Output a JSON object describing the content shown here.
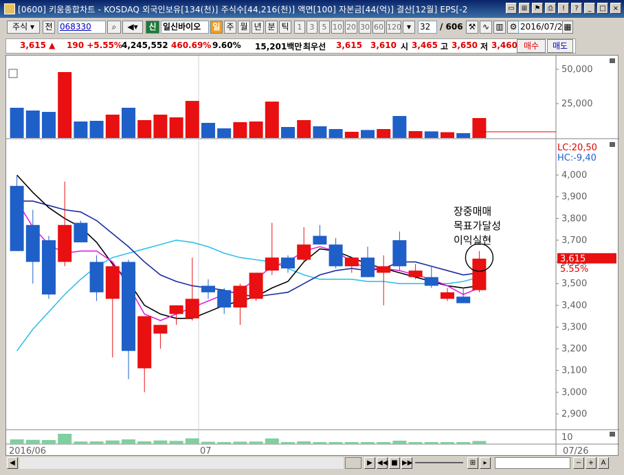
{
  "window": {
    "title": "[0600] 키움종합차트 - KOSDAQ 외국인보유[134(천)] 주식수[44,216(천)] 액면[100] 자본금[44(억)] 결산[12월] EPS[-2"
  },
  "toolbar": {
    "market_label": "주식",
    "prev_label": "전",
    "code": "068330",
    "new_badge": "신",
    "stock_name": "일신바이오",
    "day_badge": "일",
    "week": "주",
    "month": "월",
    "year": "년",
    "minute": "분",
    "tick": "틱",
    "intervals": [
      "1",
      "3",
      "5",
      "10",
      "20",
      "30",
      "60",
      "120"
    ],
    "count": "32",
    "total": "/ 606",
    "date": "2016/07/2"
  },
  "price": {
    "current": "3,615 ▲",
    "change": "190 +5.55%",
    "volume": "4,245,552",
    "vol_ratio": "460.69%",
    "turnover": "9.60%",
    "amount": "15,201백만",
    "best_label": "최우선",
    "ask": "3,615",
    "bid": "3,610",
    "open_label": "시",
    "open": "3,465",
    "high_label": "고",
    "high": "3,650",
    "low_label": "저",
    "low": "3,460",
    "buy_label": "매수",
    "sell_label": "매도"
  },
  "chart_data": {
    "type": "candlestick",
    "bullish_color": "#e81010",
    "bearish_color": "#1f5fc8",
    "volume_axis": {
      "ticks": [
        "50,000",
        "25,000"
      ],
      "ylim": [
        0,
        55000
      ]
    },
    "price_axis": {
      "ticks": [
        "4,000",
        "3,900",
        "3,800",
        "3,700",
        "3,600",
        "3,500",
        "3,400",
        "3,300",
        "3,200",
        "3,100",
        "3,000",
        "2,900"
      ],
      "ylim": [
        2830,
        4080
      ]
    },
    "lc_label": "LC:20,50",
    "hc_label": "HC:-9,40",
    "last_price_tag": "3,615",
    "last_change_tag": "5.55%",
    "sub_axis_tick": "10",
    "x_labels": [
      "2016/06",
      "07",
      "07/26"
    ],
    "candles": [
      {
        "o": 3950,
        "h": 4000,
        "l": 3650,
        "c": 3650,
        "v": 22000
      },
      {
        "o": 3770,
        "h": 3840,
        "l": 3500,
        "c": 3600,
        "v": 20000
      },
      {
        "o": 3700,
        "h": 3720,
        "l": 3430,
        "c": 3450,
        "v": 19000
      },
      {
        "o": 3600,
        "h": 3970,
        "l": 3580,
        "c": 3770,
        "v": 48000
      },
      {
        "o": 3780,
        "h": 3790,
        "l": 3690,
        "c": 3690,
        "v": 12000
      },
      {
        "o": 3600,
        "h": 3630,
        "l": 3420,
        "c": 3460,
        "v": 12500
      },
      {
        "o": 3430,
        "h": 3590,
        "l": 3160,
        "c": 3580,
        "v": 17000
      },
      {
        "o": 3600,
        "h": 3610,
        "l": 3060,
        "c": 3190,
        "v": 22000
      },
      {
        "o": 3110,
        "h": 3350,
        "l": 3000,
        "c": 3350,
        "v": 13000
      },
      {
        "o": 3270,
        "h": 3310,
        "l": 3200,
        "c": 3310,
        "v": 17000
      },
      {
        "o": 3360,
        "h": 3380,
        "l": 3310,
        "c": 3400,
        "v": 15000
      },
      {
        "o": 3340,
        "h": 3620,
        "l": 3330,
        "c": 3430,
        "v": 27000
      },
      {
        "o": 3490,
        "h": 3520,
        "l": 3430,
        "c": 3460,
        "v": 11000
      },
      {
        "o": 3470,
        "h": 3480,
        "l": 3360,
        "c": 3390,
        "v": 7000
      },
      {
        "o": 3390,
        "h": 3500,
        "l": 3310,
        "c": 3490,
        "v": 11500
      },
      {
        "o": 3430,
        "h": 3550,
        "l": 3420,
        "c": 3550,
        "v": 12000
      },
      {
        "o": 3560,
        "h": 3780,
        "l": 3540,
        "c": 3620,
        "v": 26500
      },
      {
        "o": 3620,
        "h": 3630,
        "l": 3550,
        "c": 3570,
        "v": 8000
      },
      {
        "o": 3610,
        "h": 3760,
        "l": 3600,
        "c": 3680,
        "v": 13000
      },
      {
        "o": 3720,
        "h": 3770,
        "l": 3680,
        "c": 3680,
        "v": 8500
      },
      {
        "o": 3680,
        "h": 3710,
        "l": 3570,
        "c": 3580,
        "v": 6500
      },
      {
        "o": 3580,
        "h": 3620,
        "l": 3550,
        "c": 3620,
        "v": 4500
      },
      {
        "o": 3620,
        "h": 3670,
        "l": 3530,
        "c": 3530,
        "v": 5800
      },
      {
        "o": 3550,
        "h": 3630,
        "l": 3400,
        "c": 3580,
        "v": 6500
      },
      {
        "o": 3700,
        "h": 3740,
        "l": 3560,
        "c": 3580,
        "v": 16000
      },
      {
        "o": 3530,
        "h": 3590,
        "l": 3520,
        "c": 3560,
        "v": 5000
      },
      {
        "o": 3530,
        "h": 3580,
        "l": 3480,
        "c": 3490,
        "v": 4800
      },
      {
        "o": 3430,
        "h": 3480,
        "l": 3420,
        "c": 3460,
        "v": 4200
      },
      {
        "o": 3440,
        "h": 3480,
        "l": 3420,
        "c": 3410,
        "v": 3500
      },
      {
        "o": 3470,
        "h": 3650,
        "l": 3460,
        "c": 3615,
        "v": 14500
      }
    ],
    "ma_black": [
      4000,
      3920,
      3850,
      3800,
      3760,
      3690,
      3590,
      3510,
      3400,
      3360,
      3340,
      3340,
      3370,
      3400,
      3420,
      3440,
      3480,
      3510,
      3600,
      3660,
      3650,
      3620,
      3590,
      3570,
      3550,
      3530,
      3510,
      3490,
      3480,
      3490
    ],
    "ma_magenta": [
      3880,
      3760,
      3680,
      3640,
      3650,
      3650,
      3600,
      3490,
      3360,
      3330,
      3360,
      3390,
      3420,
      3450,
      3470,
      3520,
      3580,
      3600,
      3650,
      3670,
      3650,
      3600,
      3570,
      3570,
      3560,
      3540,
      3520,
      3490,
      3450,
      3480
    ],
    "ma_navy": [
      3880,
      3880,
      3860,
      3840,
      3830,
      3790,
      3730,
      3670,
      3600,
      3540,
      3510,
      3490,
      3480,
      3470,
      3450,
      3440,
      3450,
      3460,
      3500,
      3540,
      3560,
      3570,
      3560,
      3570,
      3600,
      3600,
      3580,
      3560,
      3540,
      3550
    ],
    "ma_cyan": [
      3190,
      3290,
      3370,
      3450,
      3520,
      3580,
      3620,
      3640,
      3660,
      3680,
      3700,
      3690,
      3670,
      3640,
      3620,
      3610,
      3600,
      3570,
      3540,
      3520,
      3520,
      3520,
      3510,
      3510,
      3500,
      3500,
      3500,
      3500,
      3510,
      3530
    ],
    "annotation": [
      "장중매매",
      "목표가달성",
      "이익실현"
    ]
  }
}
